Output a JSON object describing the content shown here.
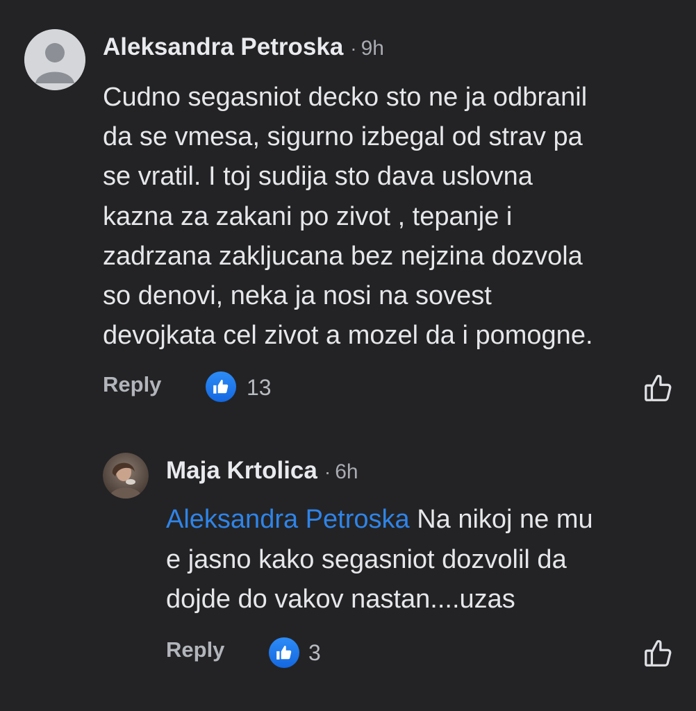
{
  "comments": [
    {
      "author": "Aleksandra Petroska",
      "separator": "·",
      "time": "9h",
      "text": "Cudno segasniot decko sto ne ja odbranil\nda se vmesa, sigurno izbegal od strav pa\nse vratil. I toj sudija sto dava uslovna\nkazna za zakani po zivot , tepanje i\nzadrzana zakljucana bez nejzina dozvola\nso denovi, neka ja nosi na sovest\ndevojkata cel zivot a mozel da i pomogne.",
      "reply_label": "Reply",
      "reaction_count": "13",
      "avatar_icon": "default-user-avatar",
      "reaction_icon": "thumbs-up-reaction",
      "like_icon": "thumbs-up-outline"
    },
    {
      "author": "Maja Krtolica",
      "separator": "·",
      "time": "6h",
      "mention": "Aleksandra Petroska",
      "text_after_mention": " Na nikoj ne mu\ne jasno kako segasniot dozvolil da\ndojde do vakov nastan....uzas",
      "reply_label": "Reply",
      "reaction_count": "3",
      "avatar_icon": "user-photo-avatar",
      "reaction_icon": "thumbs-up-reaction",
      "like_icon": "thumbs-up-outline"
    }
  ],
  "colors": {
    "background": "#232325",
    "mention": "#2f84e8",
    "reaction_blue": "#1877f2",
    "text": "#e6e7ea",
    "muted": "#a8abb1"
  }
}
